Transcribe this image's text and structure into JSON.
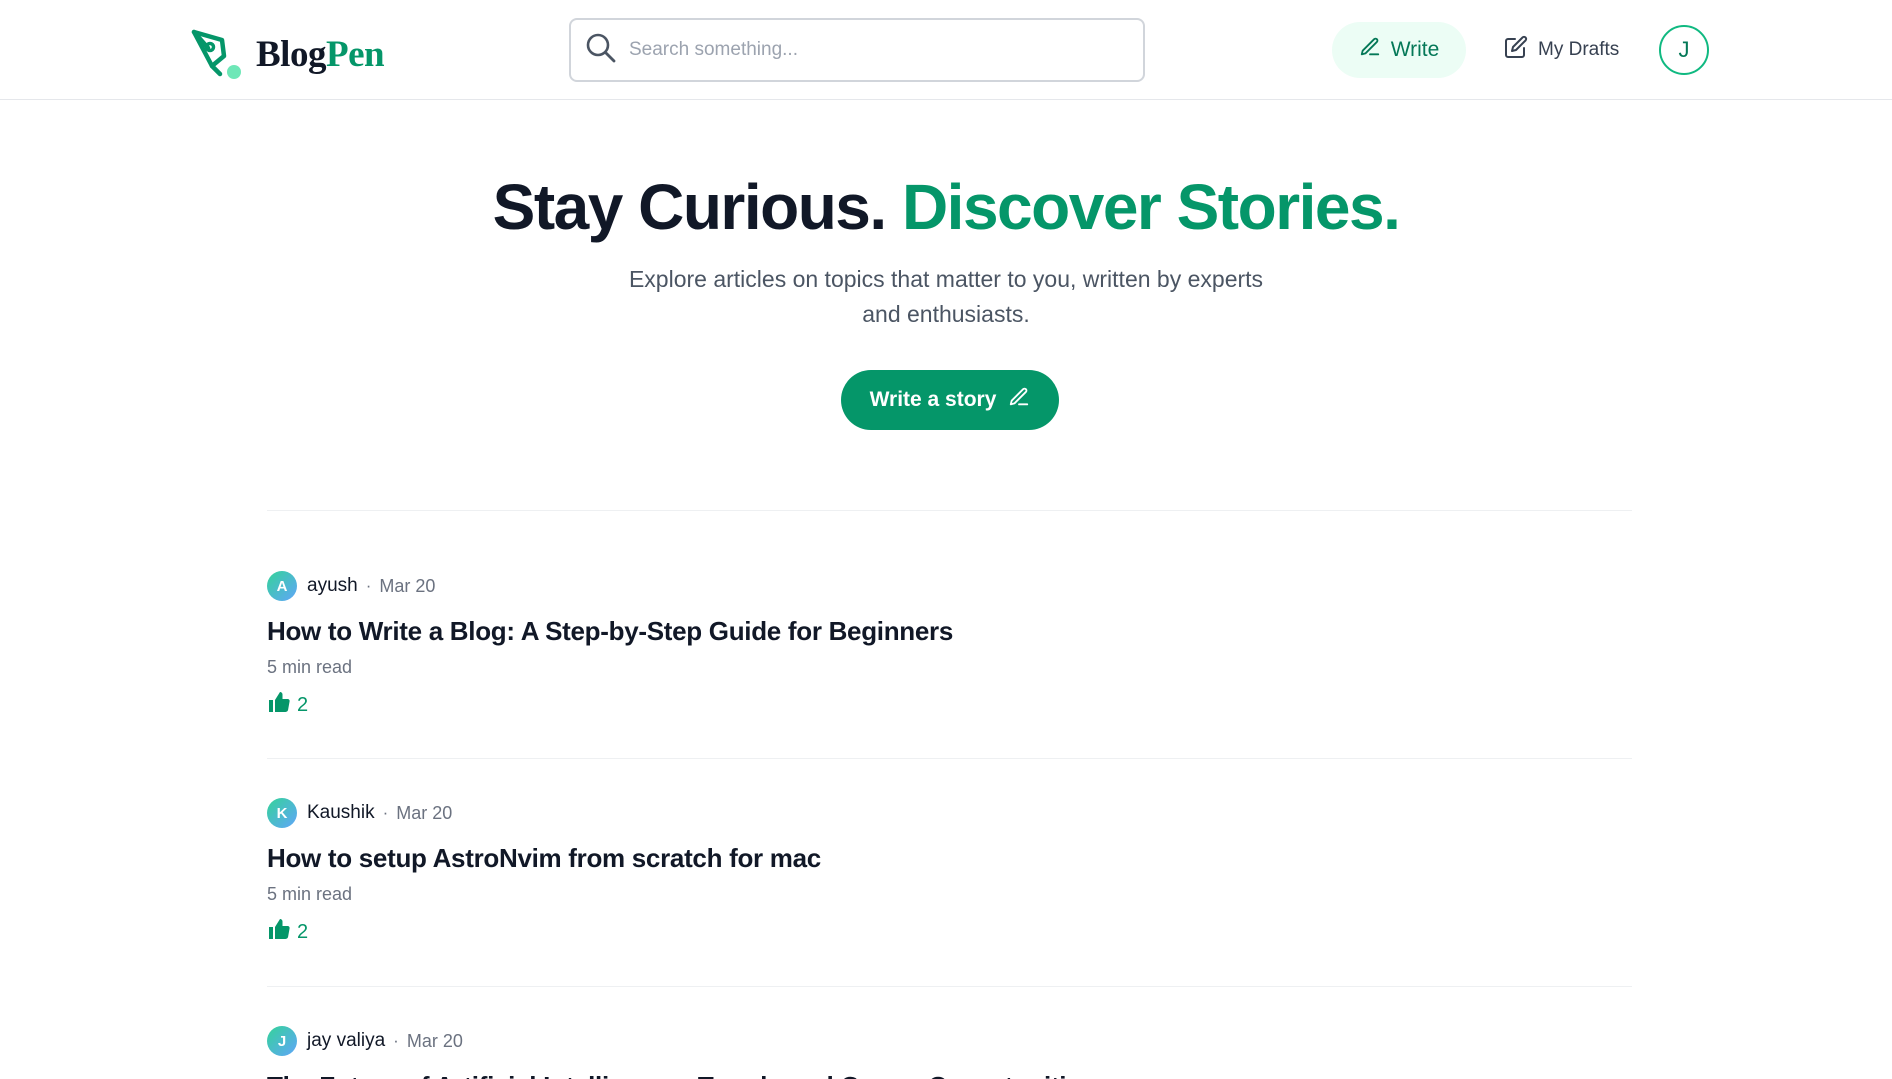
{
  "brand": {
    "part1": "Blog",
    "part2": "Pen",
    "accent_color": "#059669"
  },
  "header": {
    "search_placeholder": "Search something...",
    "write_label": "Write",
    "drafts_label": "My Drafts",
    "avatar_initial": "J"
  },
  "hero": {
    "title_main": "Stay Curious.",
    "title_accent": "Discover Stories.",
    "subtitle_line1": "Explore articles on topics that matter to you, written by experts",
    "subtitle_line2": "and enthusiasts.",
    "cta_label": "Write a story"
  },
  "articles": [
    {
      "initial": "A",
      "author": "ayush",
      "date": "Mar 20",
      "title": "How to Write a Blog: A Step-by-Step Guide for Beginners",
      "read_time": "5 min read",
      "likes": "2"
    },
    {
      "initial": "K",
      "author": "Kaushik",
      "date": "Mar 20",
      "title": "How to setup AstroNvim from scratch for mac",
      "read_time": "5 min read",
      "likes": "2"
    },
    {
      "initial": "J",
      "author": "jay valiya",
      "date": "Mar 20",
      "title": "The Future of Artificial Intelligence: Trends and Career Opportunities",
      "read_time": "",
      "likes": ""
    }
  ],
  "separator": "·"
}
